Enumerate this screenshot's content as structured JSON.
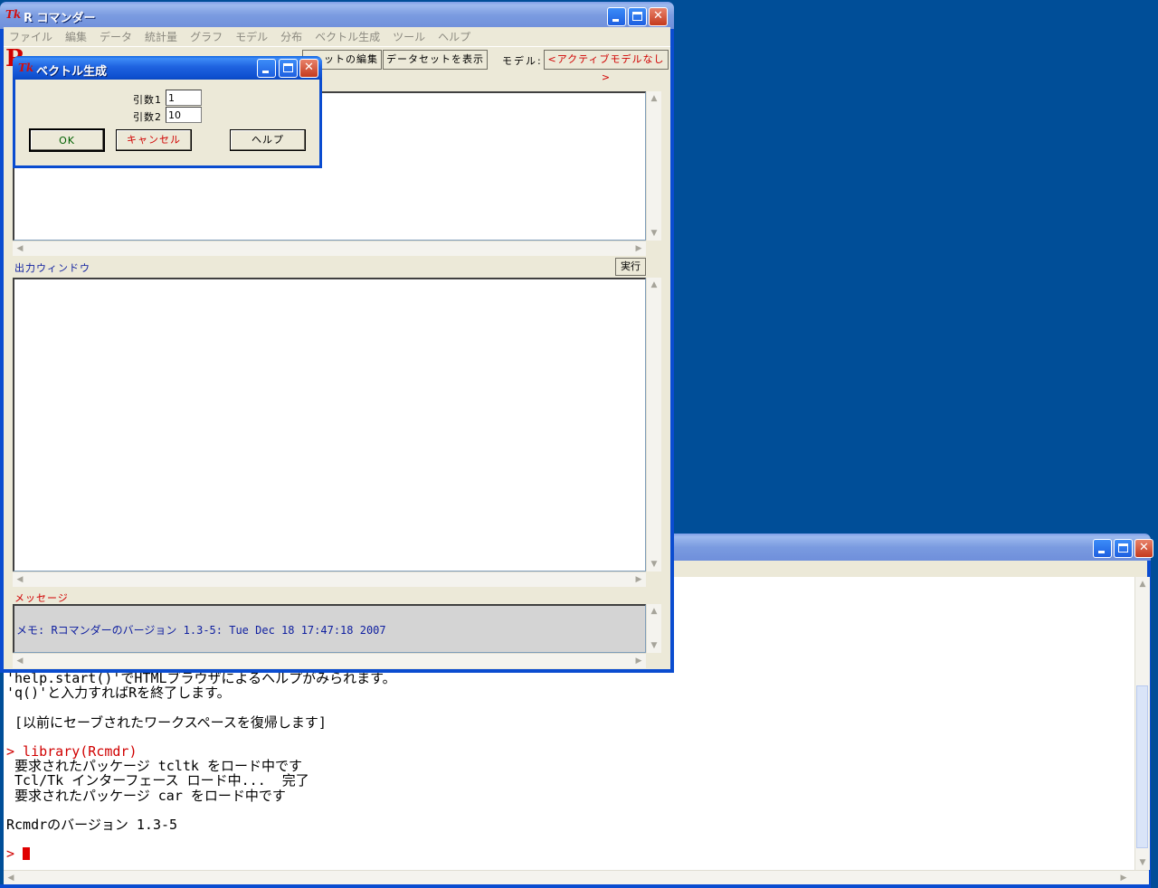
{
  "rcmdr": {
    "title": "R コマンダー",
    "menu": [
      "ファイル",
      "編集",
      "データ",
      "統計量",
      "グラフ",
      "モデル",
      "分布",
      "ベクトル生成",
      "ツール",
      "ヘルプ"
    ],
    "toolbar": {
      "edit_dataset_label": "ットの編集",
      "view_dataset_label": "データセットを表示",
      "model_label": "モデル:",
      "active_model": "<アクティブモデルなし>"
    },
    "output_window_label": "出力ウィンドウ",
    "run_button": "実行",
    "messages_label": "メッセージ",
    "message_text": "メモ: Rコマンダーのバージョン 1.3-5: Tue Dec 18 17:47:18 2007"
  },
  "dialog": {
    "title": "ベクトル生成",
    "arg1_label": "引数1",
    "arg1_value": "1",
    "arg2_label": "引数2",
    "arg2_value": "10",
    "ok": "OK",
    "cancel": "キャンセル",
    "help": "ヘルプ"
  },
  "console": {
    "lines": [
      {
        "text": "'help.start()'でHTMLブラウザによるヘルプがみられます。",
        "color": "#000000"
      },
      {
        "text": "'q()'と入力すればRを終了します。",
        "color": "#000000"
      },
      {
        "text": "",
        "color": "#000000"
      },
      {
        "text": " [以前にセーブされたワークスペースを復帰します]",
        "color": "#000000"
      },
      {
        "text": "",
        "color": "#000000"
      },
      {
        "text": "> library(Rcmdr)",
        "color": "#D00000"
      },
      {
        "text": " 要求されたパッケージ tcltk をロード中です",
        "color": "#000000"
      },
      {
        "text": " Tcl/Tk インターフェース ロード中...  完了",
        "color": "#000000"
      },
      {
        "text": " 要求されたパッケージ car をロード中です",
        "color": "#000000"
      },
      {
        "text": "",
        "color": "#000000"
      },
      {
        "text": "Rcmdrのバージョン 1.3-5",
        "color": "#000000"
      },
      {
        "text": "",
        "color": "#000000"
      }
    ],
    "prompt": ">"
  },
  "colors": {
    "desktop": "#004E98",
    "title_active": "#0A5FE0",
    "accent_red": "#D00000",
    "link_blue": "#1020A0"
  }
}
